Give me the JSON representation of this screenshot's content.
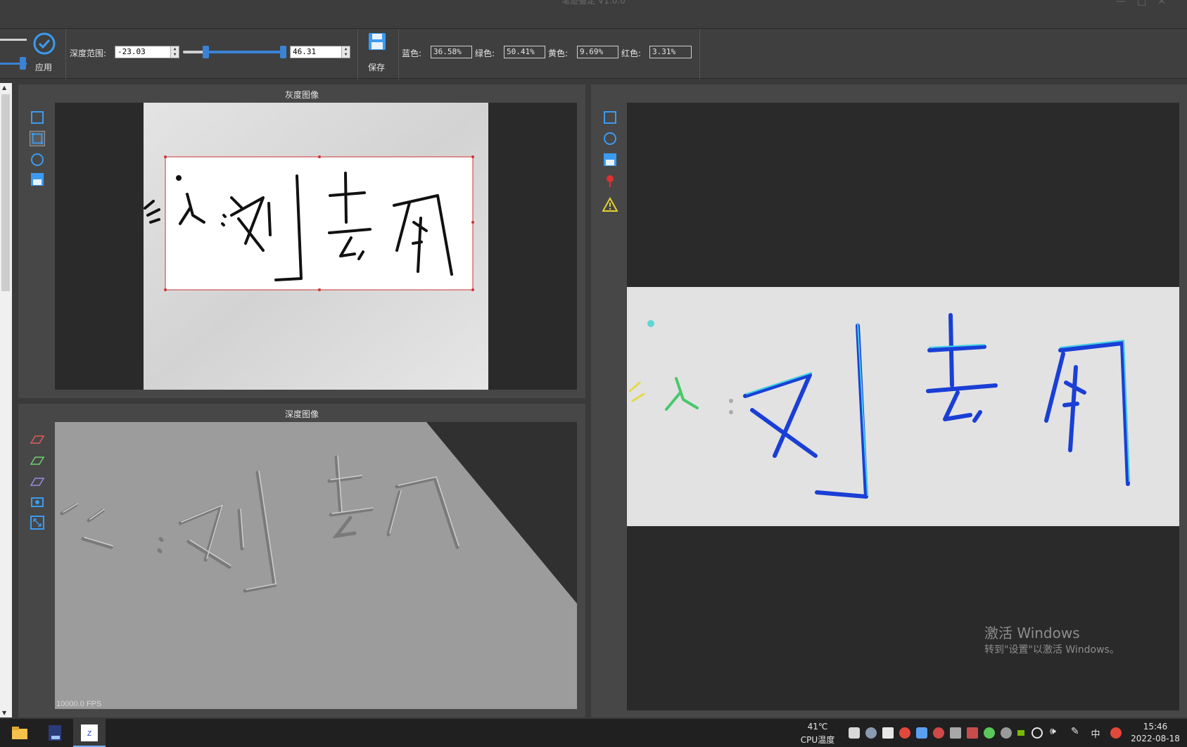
{
  "window": {
    "title": "笔迹鉴定 V1.0.0"
  },
  "toolbar": {
    "apply_label": "应用",
    "depth_range_label": "深度范围:",
    "depth_min": "-23.03",
    "depth_max": "46.31",
    "save_label": "保存",
    "stats": [
      {
        "label": "蓝色:",
        "value": "36.58%"
      },
      {
        "label": "绿色:",
        "value": "50.41%"
      },
      {
        "label": "黄色:",
        "value": "9.69%"
      },
      {
        "label": "红色:",
        "value": "3.31%"
      }
    ]
  },
  "gray_panel": {
    "title": "灰度图像"
  },
  "depth_panel": {
    "title": "深度图像",
    "fps": "10000.0 FPS"
  },
  "watermark": {
    "line1": "激活 Windows",
    "line2": "转到\"设置\"以激活 Windows。"
  },
  "taskbar": {
    "temp": "41℃",
    "temp_label": "CPU温度",
    "ime": "中",
    "time": "15:46",
    "date": "2022-08-18"
  },
  "colors": {
    "accent": "#3b82d6",
    "panel_bg": "#474747",
    "viewport_bg": "#2a2a2a",
    "heat_blue": "#1a3fd6",
    "heat_cyan": "#3fd0e8",
    "heat_yellow": "#e6d84a"
  }
}
